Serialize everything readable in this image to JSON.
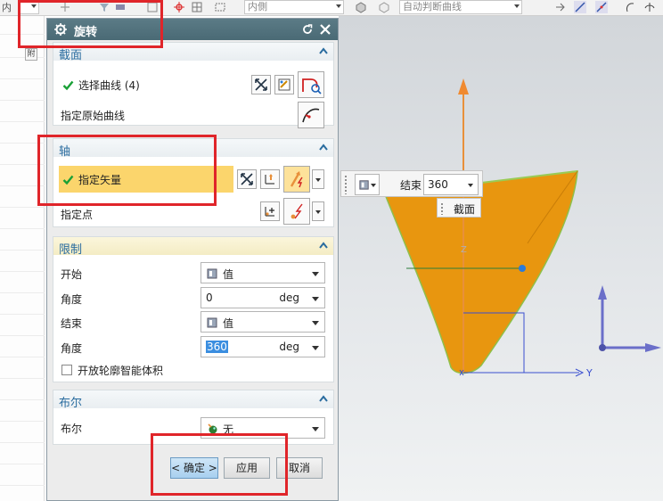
{
  "toolbar": {
    "left_fragment": "内",
    "combo_body": "内側",
    "combo_intersect": "自动判断曲线"
  },
  "left_strip": {
    "column_letter": "附"
  },
  "dialog": {
    "title": "旋转",
    "section": {
      "title": "截面",
      "select_curve_label": "选择曲线 (4)",
      "specify_origin_curve_label": "指定原始曲线"
    },
    "axis": {
      "title": "轴",
      "specify_vector_label": "指定矢量",
      "specify_point_label": "指定点"
    },
    "limits": {
      "title": "限制",
      "start_label": "开始",
      "start_type": "值",
      "start_angle_label": "角度",
      "start_angle_value": "0",
      "start_angle_unit": "deg",
      "end_label": "结束",
      "end_type": "值",
      "end_angle_label": "角度",
      "end_angle_value": "360",
      "end_angle_unit": "deg",
      "open_profile_label": "开放轮廓智能体积",
      "open_profile_checked": false
    },
    "boolean": {
      "title": "布尔",
      "label": "布尔",
      "value": "无"
    },
    "buttons": {
      "ok": "< 确定 >",
      "apply": "应用",
      "cancel": "取消"
    }
  },
  "onscreen_input": {
    "end_label": "结束",
    "end_value": "360",
    "tooltip": "截面"
  },
  "viewport": {
    "axis_z": "Z",
    "axis_y": "Y"
  },
  "colors": {
    "solid_orange": "#e8960f",
    "selected_row": "#fbd56c",
    "highlight_red": "#e0252a",
    "title_bar": "#4f6f7a",
    "group_title_blue": "#2a6c9f"
  }
}
